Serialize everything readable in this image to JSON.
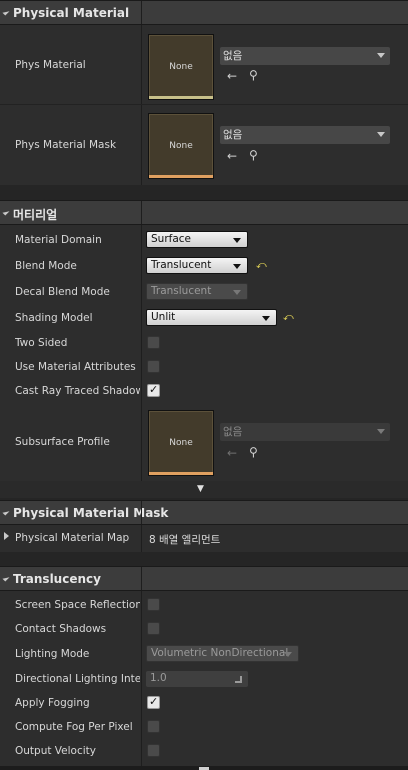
{
  "physical_material": {
    "header": "Physical Material",
    "phys_material": {
      "label": "Phys Material",
      "thumb_text": "None",
      "value": "없음"
    },
    "phys_material_mask": {
      "label": "Phys Material Mask",
      "thumb_text": "None",
      "value": "없음"
    }
  },
  "material": {
    "header": "머티리얼",
    "material_domain": {
      "label": "Material Domain",
      "value": "Surface"
    },
    "blend_mode": {
      "label": "Blend Mode",
      "value": "Translucent"
    },
    "decal_blend_mode": {
      "label": "Decal Blend Mode",
      "value": "Translucent"
    },
    "shading_model": {
      "label": "Shading Model",
      "value": "Unlit"
    },
    "two_sided": {
      "label": "Two Sided",
      "checked": false
    },
    "use_material_attributes": {
      "label": "Use Material Attributes",
      "checked": false
    },
    "cast_ray_traced_shadow": {
      "label": "Cast Ray Traced Shadow",
      "checked": true
    },
    "subsurface_profile": {
      "label": "Subsurface Profile",
      "thumb_text": "None",
      "value": "없음"
    }
  },
  "physical_material_mask": {
    "header": "Physical Material Mask",
    "map": {
      "label": "Physical Material Map",
      "value": "8 배열 엘리먼트"
    }
  },
  "translucency": {
    "header": "Translucency",
    "screen_space_reflections": {
      "label": "Screen Space Reflections",
      "checked": false
    },
    "contact_shadows": {
      "label": "Contact Shadows",
      "checked": false
    },
    "lighting_mode": {
      "label": "Lighting Mode",
      "value": "Volumetric NonDirectional"
    },
    "directional_lighting_intensity": {
      "label": "Directional Lighting Inten",
      "value": "1.0"
    },
    "apply_fogging": {
      "label": "Apply Fogging",
      "checked": true
    },
    "compute_fog_per_pixel": {
      "label": "Compute Fog Per Pixel",
      "checked": false
    },
    "output_velocity": {
      "label": "Output Velocity",
      "checked": false
    }
  },
  "icons": {
    "use_asset": "←",
    "browse": "⚲",
    "reset": "⤺",
    "expand_arrow": "▼"
  },
  "colors": {
    "reset_arrow": "#f0e05a",
    "accent_bar": "#c8c08a",
    "accent_bar_orange": "#e0a060"
  }
}
